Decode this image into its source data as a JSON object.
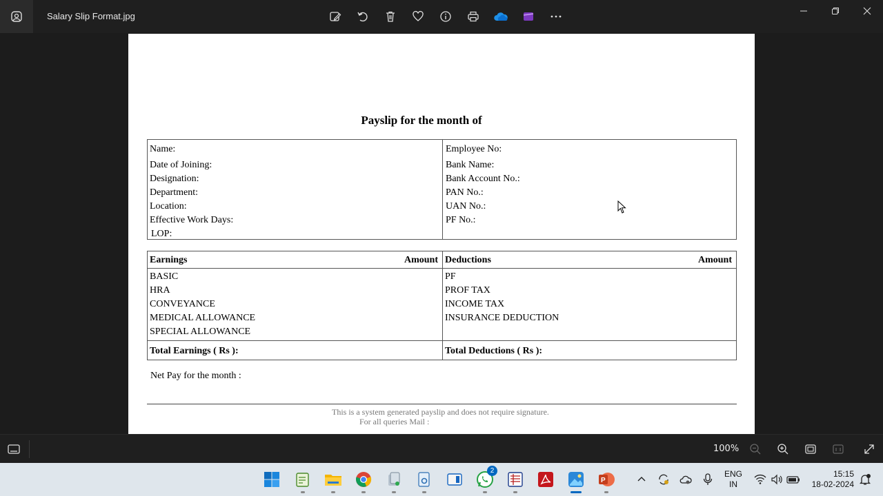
{
  "window": {
    "title": "Salary Slip Format.jpg"
  },
  "document": {
    "title": "Payslip for the month of",
    "info_left": [
      "Name:",
      "Date of Joining:",
      "Designation:",
      "Department:",
      "Location:",
      "Effective Work Days:",
      "LOP:"
    ],
    "info_right": [
      "Employee No:",
      "Bank Name:",
      "Bank Account No.:",
      "PAN No.:",
      "UAN No.:",
      "PF No.:"
    ],
    "earnings_header": "Earnings",
    "amount_header": "Amount",
    "deductions_header": "Deductions",
    "earnings": [
      "BASIC",
      "HRA",
      "CONVEYANCE",
      "MEDICAL ALLOWANCE",
      "SPECIAL ALLOWANCE"
    ],
    "deductions": [
      "PF",
      "PROF TAX",
      "INCOME TAX",
      "INSURANCE DEDUCTION"
    ],
    "total_earnings": "Total Earnings ( Rs ):",
    "total_deductions": "Total Deductions ( Rs ):",
    "net_pay": "Net Pay for the month :",
    "footer_line1": "This is a system generated payslip and does not require signature.",
    "footer_line2": "For all queries Mail :"
  },
  "statusbar": {
    "zoom": "100%"
  },
  "taskbar": {
    "whatsapp_badge": "2",
    "lang_line1": "ENG",
    "lang_line2": "IN",
    "time": "15:15",
    "date": "18-02-2024"
  },
  "colors": {
    "accent": "#0067c0",
    "titlebar": "#1f1f1f",
    "taskbar": "#dfe6ec"
  }
}
